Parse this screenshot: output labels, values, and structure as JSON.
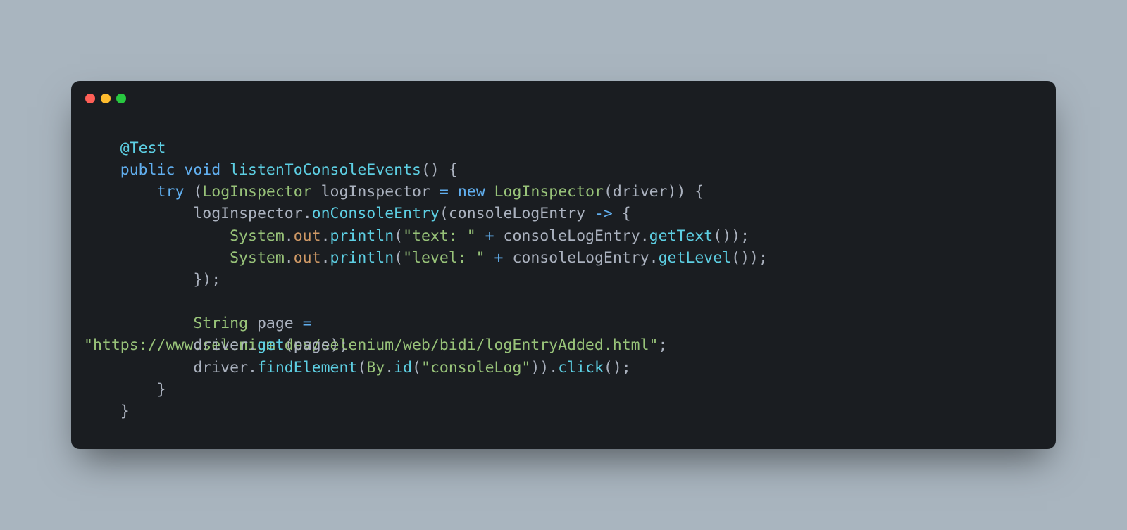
{
  "windowControls": [
    "close",
    "minimize",
    "maximize"
  ],
  "code": {
    "lines": [
      {
        "indent": 4,
        "tokens": [
          {
            "t": "ann",
            "v": "@Test"
          }
        ]
      },
      {
        "indent": 4,
        "tokens": [
          {
            "t": "kw",
            "v": "public"
          },
          {
            "t": "sp",
            "v": " "
          },
          {
            "t": "kw",
            "v": "void"
          },
          {
            "t": "sp",
            "v": " "
          },
          {
            "t": "method",
            "v": "listenToConsoleEvents"
          },
          {
            "t": "punct",
            "v": "() {"
          }
        ]
      },
      {
        "indent": 8,
        "tokens": [
          {
            "t": "kw",
            "v": "try"
          },
          {
            "t": "sp",
            "v": " "
          },
          {
            "t": "punct",
            "v": "("
          },
          {
            "t": "type",
            "v": "LogInspector"
          },
          {
            "t": "sp",
            "v": " "
          },
          {
            "t": "ident",
            "v": "logInspector"
          },
          {
            "t": "sp",
            "v": " "
          },
          {
            "t": "op",
            "v": "="
          },
          {
            "t": "sp",
            "v": " "
          },
          {
            "t": "new",
            "v": "new"
          },
          {
            "t": "sp",
            "v": " "
          },
          {
            "t": "type",
            "v": "LogInspector"
          },
          {
            "t": "punct",
            "v": "("
          },
          {
            "t": "ident",
            "v": "driver"
          },
          {
            "t": "punct",
            "v": ")) {"
          }
        ]
      },
      {
        "indent": 12,
        "tokens": [
          {
            "t": "ident",
            "v": "logInspector"
          },
          {
            "t": "punct",
            "v": "."
          },
          {
            "t": "method",
            "v": "onConsoleEntry"
          },
          {
            "t": "punct",
            "v": "("
          },
          {
            "t": "ident",
            "v": "consoleLogEntry"
          },
          {
            "t": "sp",
            "v": " "
          },
          {
            "t": "op",
            "v": "->"
          },
          {
            "t": "sp",
            "v": " "
          },
          {
            "t": "punct",
            "v": "{"
          }
        ]
      },
      {
        "indent": 16,
        "tokens": [
          {
            "t": "type",
            "v": "System"
          },
          {
            "t": "punct",
            "v": "."
          },
          {
            "t": "prop",
            "v": "out"
          },
          {
            "t": "punct",
            "v": "."
          },
          {
            "t": "method",
            "v": "println"
          },
          {
            "t": "punct",
            "v": "("
          },
          {
            "t": "str",
            "v": "\"text: \""
          },
          {
            "t": "sp",
            "v": " "
          },
          {
            "t": "op",
            "v": "+"
          },
          {
            "t": "sp",
            "v": " "
          },
          {
            "t": "ident",
            "v": "consoleLogEntry"
          },
          {
            "t": "punct",
            "v": "."
          },
          {
            "t": "method",
            "v": "getText"
          },
          {
            "t": "punct",
            "v": "());"
          }
        ]
      },
      {
        "indent": 16,
        "tokens": [
          {
            "t": "type",
            "v": "System"
          },
          {
            "t": "punct",
            "v": "."
          },
          {
            "t": "prop",
            "v": "out"
          },
          {
            "t": "punct",
            "v": "."
          },
          {
            "t": "method",
            "v": "println"
          },
          {
            "t": "punct",
            "v": "("
          },
          {
            "t": "str",
            "v": "\"level: \""
          },
          {
            "t": "sp",
            "v": " "
          },
          {
            "t": "op",
            "v": "+"
          },
          {
            "t": "sp",
            "v": " "
          },
          {
            "t": "ident",
            "v": "consoleLogEntry"
          },
          {
            "t": "punct",
            "v": "."
          },
          {
            "t": "method",
            "v": "getLevel"
          },
          {
            "t": "punct",
            "v": "());"
          }
        ]
      },
      {
        "indent": 12,
        "tokens": [
          {
            "t": "punct",
            "v": "});"
          }
        ]
      },
      {
        "indent": 0,
        "tokens": []
      },
      {
        "indent": 12,
        "tokens": [
          {
            "t": "type",
            "v": "String"
          },
          {
            "t": "sp",
            "v": " "
          },
          {
            "t": "ident",
            "v": "page"
          },
          {
            "t": "sp",
            "v": " "
          },
          {
            "t": "op",
            "v": "="
          }
        ]
      },
      {
        "indent": 0,
        "overlay": "            driver.get(page);",
        "tokens": [
          {
            "t": "str",
            "v": "\"https://www.selenium.dev/selenium/web/bidi/logEntryAdded.html\""
          },
          {
            "t": "punct",
            "v": ";"
          }
        ]
      },
      {
        "indent": 12,
        "tokens": [
          {
            "t": "ident",
            "v": "driver"
          },
          {
            "t": "punct",
            "v": "."
          },
          {
            "t": "method",
            "v": "findElement"
          },
          {
            "t": "punct",
            "v": "("
          },
          {
            "t": "type",
            "v": "By"
          },
          {
            "t": "punct",
            "v": "."
          },
          {
            "t": "method",
            "v": "id"
          },
          {
            "t": "punct",
            "v": "("
          },
          {
            "t": "str",
            "v": "\"consoleLog\""
          },
          {
            "t": "punct",
            "v": "))."
          },
          {
            "t": "method",
            "v": "click"
          },
          {
            "t": "punct",
            "v": "();"
          }
        ]
      },
      {
        "indent": 8,
        "tokens": [
          {
            "t": "punct",
            "v": "}"
          }
        ]
      },
      {
        "indent": 4,
        "tokens": [
          {
            "t": "punct",
            "v": "}"
          }
        ]
      }
    ]
  }
}
